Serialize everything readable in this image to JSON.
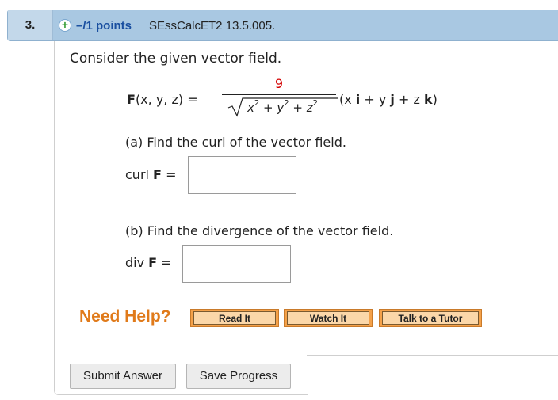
{
  "question": {
    "number": "3.",
    "points": "–/1 points",
    "id": "SEssCalcET2 13.5.005.",
    "prompt": "Consider the given vector field."
  },
  "formula": {
    "lhs_F": "F",
    "lhs_args": "(x, y, z) =",
    "numerator": "9",
    "denominator_x": "x",
    "denominator_plus1": " + ",
    "denominator_y": "y",
    "denominator_plus2": " + ",
    "denominator_z": "z",
    "exponent": "2",
    "rhs_open": "(x ",
    "rhs_i": "i",
    "rhs_plus1": " + y ",
    "rhs_j": "j",
    "rhs_plus2": " + z ",
    "rhs_k": "k",
    "rhs_close": ")"
  },
  "part_a": {
    "text": "(a) Find the curl of the vector field.",
    "label_prefix": "curl ",
    "label_F": "F",
    "label_suffix": " =",
    "value": ""
  },
  "part_b": {
    "text": "(b) Find the divergence of the vector field.",
    "label_prefix": "div ",
    "label_F": "F",
    "label_suffix": " =",
    "value": ""
  },
  "help": {
    "label": "Need Help?",
    "read_it": "Read It",
    "watch_it": "Watch It",
    "talk_to_tutor": "Talk to a Tutor"
  },
  "actions": {
    "submit": "Submit Answer",
    "save": "Save Progress"
  },
  "colors": {
    "header_bg": "#a9c8e2",
    "points_text": "#1a4fa0",
    "numerator": "#d40000",
    "need_help": "#e07a1a",
    "help_button": "#f4a14a"
  },
  "icons": {
    "expand": "plus-circle-icon"
  }
}
